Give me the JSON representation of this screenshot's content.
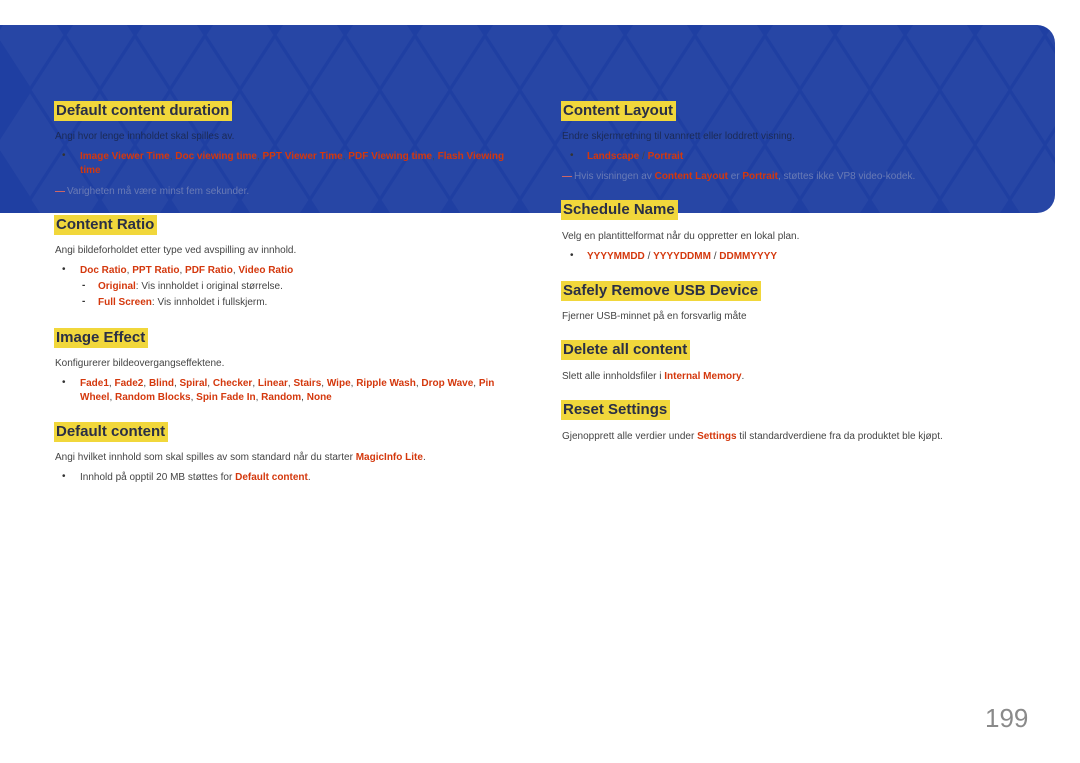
{
  "colors": {
    "banner": "#1f3fa2",
    "highlight": "#f1d73b",
    "accent": "#d4380d"
  },
  "page_number": "199",
  "left": {
    "duration": {
      "heading": "Default content duration",
      "desc": [
        [
          "Angi hvor lenge innholdet skal spilles av.",
          0
        ]
      ],
      "bullet": [
        [
          "Image Viewer Time",
          1
        ],
        [
          ", ",
          0
        ],
        [
          "Doc viewing time",
          1
        ],
        [
          ", ",
          0
        ],
        [
          "PPT Viewer Time",
          1
        ],
        [
          ", ",
          0
        ],
        [
          "PDF Viewing time",
          1
        ],
        [
          ", ",
          0
        ],
        [
          "Flash Viewing time",
          1
        ]
      ],
      "note": [
        [
          "Varigheten må være minst fem sekunder.",
          0
        ]
      ]
    },
    "ratio": {
      "heading": "Content Ratio",
      "desc": [
        [
          "Angi bildeforholdet etter type ved avspilling av innhold.",
          0
        ]
      ],
      "bullet": [
        [
          "Doc Ratio",
          1
        ],
        [
          ", ",
          0
        ],
        [
          "PPT Ratio",
          1
        ],
        [
          ", ",
          0
        ],
        [
          "PDF Ratio",
          1
        ],
        [
          ", ",
          0
        ],
        [
          "Video Ratio",
          1
        ]
      ],
      "sub1": [
        [
          "Original",
          1
        ],
        [
          ": Vis innholdet i original størrelse.",
          0
        ]
      ],
      "sub2": [
        [
          "Full Screen",
          1
        ],
        [
          ": Vis innholdet i fullskjerm.",
          0
        ]
      ]
    },
    "effect": {
      "heading": "Image Effect",
      "desc": [
        [
          "Konfigurerer bildeovergangseffektene.",
          0
        ]
      ],
      "bullet": [
        [
          "Fade1",
          1
        ],
        [
          ", ",
          0
        ],
        [
          "Fade2",
          1
        ],
        [
          ", ",
          0
        ],
        [
          "Blind",
          1
        ],
        [
          ", ",
          0
        ],
        [
          "Spiral",
          1
        ],
        [
          ", ",
          0
        ],
        [
          "Checker",
          1
        ],
        [
          ", ",
          0
        ],
        [
          "Linear",
          1
        ],
        [
          ", ",
          0
        ],
        [
          "Stairs",
          1
        ],
        [
          ", ",
          0
        ],
        [
          "Wipe",
          1
        ],
        [
          ", ",
          0
        ],
        [
          "Ripple Wash",
          1
        ],
        [
          ", ",
          0
        ],
        [
          "Drop Wave",
          1
        ],
        [
          ", ",
          0
        ],
        [
          "Pin Wheel",
          1
        ],
        [
          ", ",
          0
        ],
        [
          "Random Blocks",
          1
        ],
        [
          ", ",
          0
        ],
        [
          "Spin Fade In",
          1
        ],
        [
          ", ",
          0
        ],
        [
          "Random",
          1
        ],
        [
          ", ",
          0
        ],
        [
          "None",
          1
        ]
      ]
    },
    "default": {
      "heading": "Default content",
      "desc": [
        [
          "Angi hvilket innhold som skal spilles av som standard når du starter ",
          0
        ],
        [
          "MagicInfo Lite",
          1
        ],
        [
          ".",
          0
        ]
      ],
      "bullet": [
        [
          "Innhold på opptil 20 MB støttes for ",
          0
        ],
        [
          "Default content",
          1
        ],
        [
          ".",
          0
        ]
      ]
    }
  },
  "right": {
    "layout": {
      "heading": "Content Layout",
      "desc": [
        [
          "Endre skjermretning til vannrett eller loddrett visning.",
          0
        ]
      ],
      "bullet": [
        [
          "Landscape",
          1
        ],
        [
          " / ",
          0
        ],
        [
          "Portrait",
          1
        ]
      ],
      "note": [
        [
          "Hvis visningen av ",
          0
        ],
        [
          "Content Layout",
          1
        ],
        [
          " er ",
          0
        ],
        [
          "Portrait",
          1
        ],
        [
          ", støttes ikke VP8 video-kodek.",
          0
        ]
      ]
    },
    "schedule": {
      "heading": "Schedule Name",
      "desc": [
        [
          "Velg en plantittelformat når du oppretter en lokal plan.",
          0
        ]
      ],
      "bullet": [
        [
          "YYYYMMDD",
          1
        ],
        [
          " / ",
          0
        ],
        [
          "YYYYDDMM",
          1
        ],
        [
          " / ",
          0
        ],
        [
          "DDMMYYYY",
          1
        ]
      ]
    },
    "usb": {
      "heading": "Safely Remove USB Device",
      "desc": [
        [
          "Fjerner USB-minnet på en forsvarlig måte",
          0
        ]
      ]
    },
    "delete": {
      "heading": "Delete all content",
      "desc": [
        [
          "Slett alle innholdsfiler i ",
          0
        ],
        [
          "Internal Memory",
          1
        ],
        [
          ".",
          0
        ]
      ]
    },
    "reset": {
      "heading": "Reset Settings",
      "desc": [
        [
          "Gjenopprett alle verdier under ",
          0
        ],
        [
          "Settings",
          1
        ],
        [
          " til standardverdiene fra da produktet ble kjøpt.",
          0
        ]
      ]
    }
  }
}
